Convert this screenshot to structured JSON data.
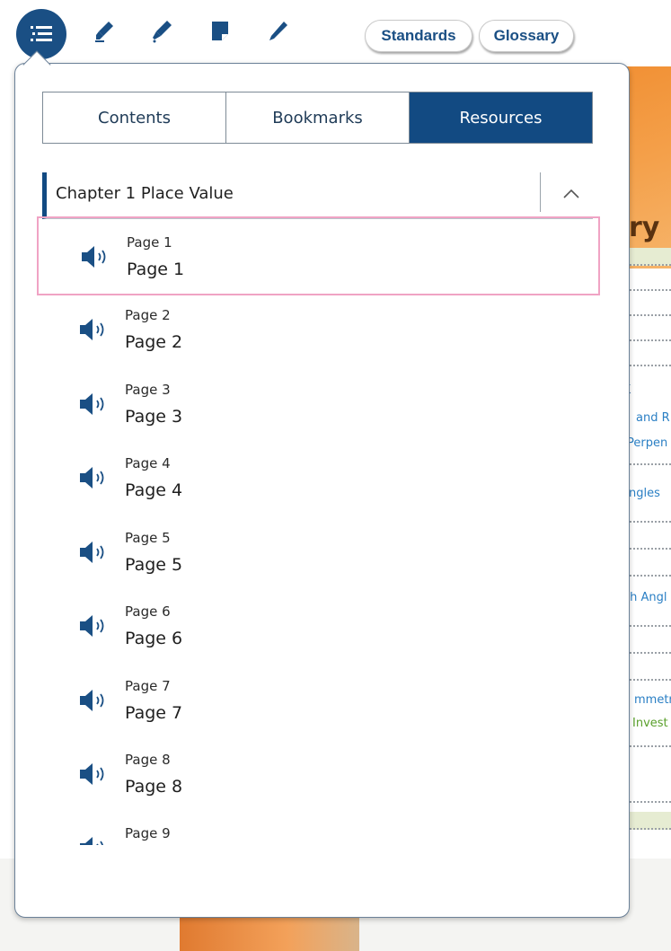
{
  "toolbar": {
    "toc_button": "table-of-contents-icon",
    "tools": [
      "highlighter-icon",
      "marker-icon",
      "note-icon",
      "pen-icon"
    ],
    "standards_label": "Standards",
    "glossary_label": "Glossary"
  },
  "background": {
    "title_fragment": "ry",
    "blue_fragments": [
      "k",
      "and R",
      "Perpen",
      "ngles",
      "th Angl",
      "mmetr"
    ],
    "green_fragments": [
      "Invest"
    ]
  },
  "panel": {
    "tabs": [
      {
        "label": "Contents",
        "active": false
      },
      {
        "label": "Bookmarks",
        "active": false
      },
      {
        "label": "Resources",
        "active": true
      }
    ],
    "chapter": {
      "title": "Chapter 1 Place Value",
      "toggle_icon": "chevron-up-icon"
    },
    "items": [
      {
        "small": "Page 1",
        "big": "Page 1",
        "icon": "audio-icon",
        "selected": true
      },
      {
        "small": "Page 2",
        "big": "Page 2",
        "icon": "audio-icon",
        "selected": false
      },
      {
        "small": "Page 3",
        "big": "Page 3",
        "icon": "audio-icon",
        "selected": false
      },
      {
        "small": "Page 4",
        "big": "Page 4",
        "icon": "audio-icon",
        "selected": false
      },
      {
        "small": "Page 5",
        "big": "Page 5",
        "icon": "audio-icon",
        "selected": false
      },
      {
        "small": "Page 6",
        "big": "Page 6",
        "icon": "audio-icon",
        "selected": false
      },
      {
        "small": "Page 7",
        "big": "Page 7",
        "icon": "audio-icon",
        "selected": false
      },
      {
        "small": "Page 8",
        "big": "Page 8",
        "icon": "audio-icon",
        "selected": false
      },
      {
        "small": "Page 9",
        "big": "",
        "icon": "audio-icon",
        "selected": false
      }
    ]
  },
  "colors": {
    "accent": "#124a82",
    "selection_border": "#f0a3c4",
    "audio_icon": "#1a4f84"
  }
}
